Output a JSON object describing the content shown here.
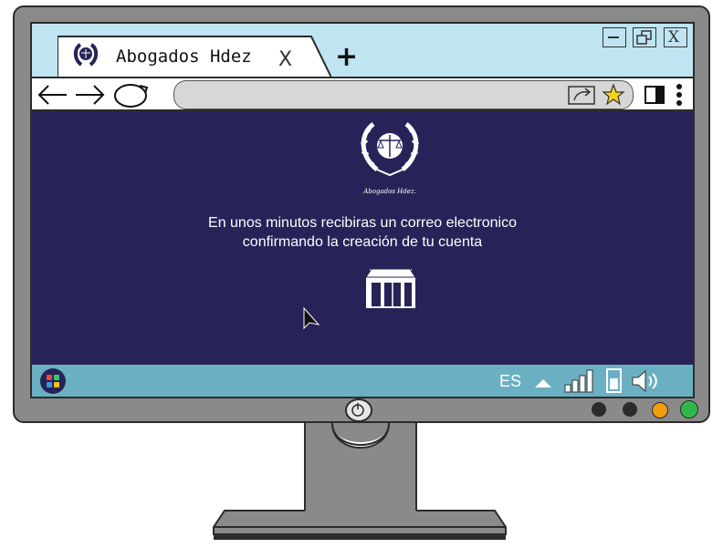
{
  "browser": {
    "tab_title": "Abogados  Hdez",
    "tab_close": "X",
    "new_tab": "+",
    "window_controls": [
      "minimize-icon",
      "restore-icon",
      "close-icon"
    ],
    "window_close_label": "X",
    "address": ""
  },
  "page": {
    "logo_caption": "Abogados Hdez.",
    "message_line1": "En unos minutos recibiras un correo electronico",
    "message_line2": "confirmando la creación de tu cuenta"
  },
  "taskbar": {
    "language": "ES"
  },
  "colors": {
    "page_background": "#272358",
    "titlebar": "#bfe4f2",
    "taskbar": "#6ab0c2",
    "monitor": "#8a8a8a",
    "led_orange": "#f39c12",
    "led_green": "#2fb84a"
  }
}
